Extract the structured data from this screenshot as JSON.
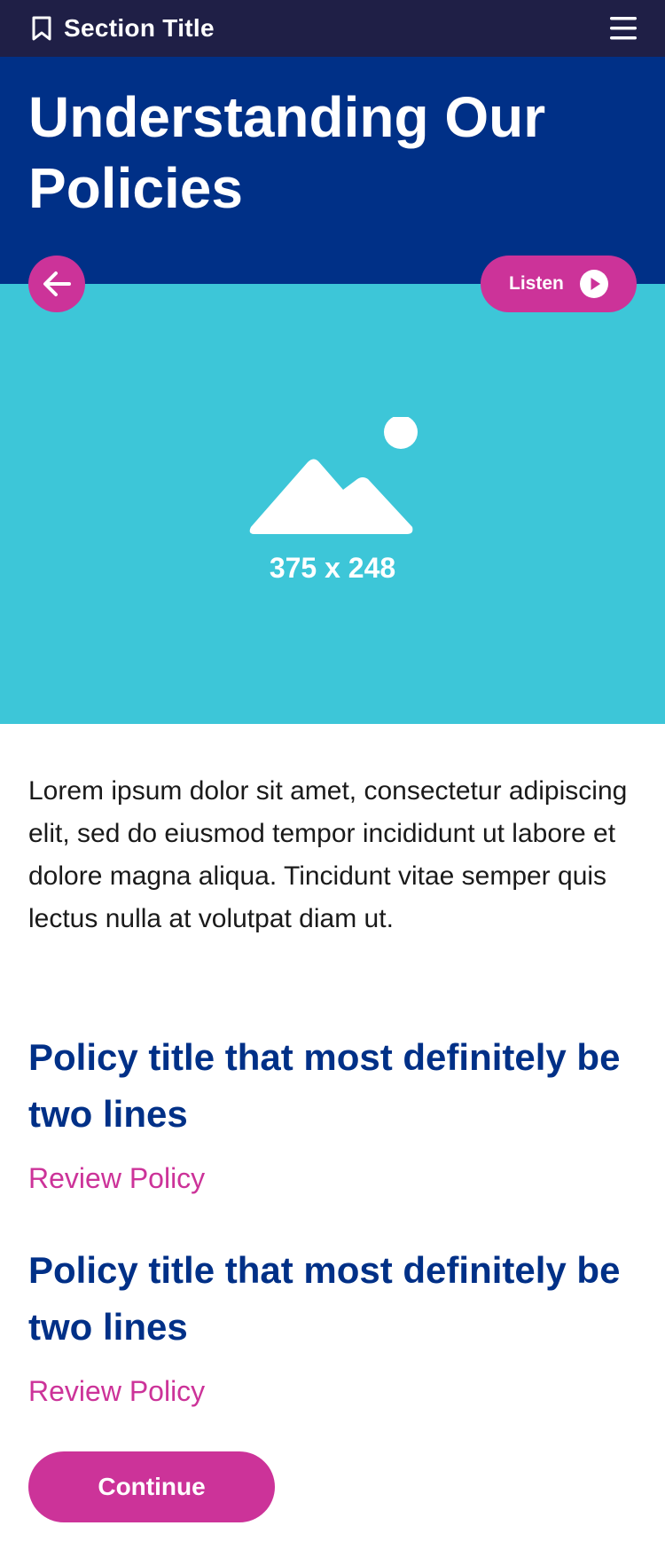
{
  "header": {
    "section_title": "Section Title",
    "bookmark_icon": "bookmark-icon",
    "menu_icon": "hamburger-menu-icon"
  },
  "hero": {
    "title": "Understanding Our Policies"
  },
  "controls": {
    "back_icon": "arrow-left-icon",
    "listen_label": "Listen",
    "listen_icon": "play-circle-icon"
  },
  "image_placeholder": {
    "caption": "375 x 248",
    "icon": "image-placeholder-icon"
  },
  "body": {
    "paragraph": "Lorem ipsum dolor sit amet, consectetur adipiscing elit, sed do eiusmod tempor incididunt ut labore et dolore magna aliqua. Tincidunt vitae semper quis lectus nulla at volutpat diam ut."
  },
  "policies": [
    {
      "title": "Policy title that most definitely be two lines",
      "link_label": "Review Policy"
    },
    {
      "title": "Policy title that most definitely be two lines",
      "link_label": "Review Policy"
    }
  ],
  "actions": {
    "continue_label": "Continue"
  },
  "colors": {
    "topbar": "#1f1f46",
    "hero_background": "#003087",
    "image_background": "#3dc6d8",
    "accent": "#cc3399",
    "heading": "#003087"
  }
}
